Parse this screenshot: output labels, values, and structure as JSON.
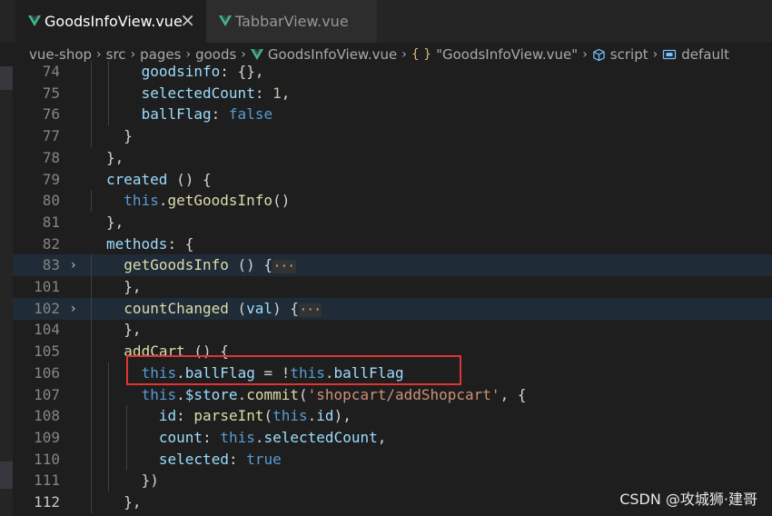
{
  "tabs": [
    {
      "label": "GoodsInfoView.vue",
      "active": true,
      "close": "×"
    },
    {
      "label": "TabbarView.vue",
      "active": false
    }
  ],
  "breadcrumb": {
    "parts": [
      "vue-shop",
      "src",
      "pages",
      "goods",
      "GoodsInfoView.vue"
    ],
    "object": "\"GoodsInfoView.vue\"",
    "script": "script",
    "default": "default"
  },
  "lines": [
    {
      "num": "74",
      "indent": 2,
      "tokens": [
        [
          "kw",
          "goodsinfo"
        ],
        [
          "p",
          ": {},"
        ]
      ]
    },
    {
      "num": "75",
      "indent": 2,
      "tokens": [
        [
          "kw",
          "selectedCount"
        ],
        [
          "p",
          ": "
        ],
        [
          "num",
          "1"
        ],
        [
          "p",
          ","
        ]
      ]
    },
    {
      "num": "76",
      "indent": 2,
      "tokens": [
        [
          "kw",
          "ballFlag"
        ],
        [
          "p",
          ": "
        ],
        [
          "bool",
          "false"
        ]
      ]
    },
    {
      "num": "77",
      "indent": 1,
      "tokens": [
        [
          "p",
          "}"
        ]
      ]
    },
    {
      "num": "78",
      "indent": 0,
      "tokens": [
        [
          "p",
          "},"
        ]
      ]
    },
    {
      "num": "79",
      "indent": 0,
      "tokens": [
        [
          "kw",
          "created"
        ],
        [
          "p",
          " () {"
        ]
      ]
    },
    {
      "num": "80",
      "indent": 1,
      "tokens": [
        [
          "this",
          "this"
        ],
        [
          "p",
          "."
        ],
        [
          "fn",
          "getGoodsInfo"
        ],
        [
          "p",
          "()"
        ]
      ]
    },
    {
      "num": "81",
      "indent": 0,
      "tokens": [
        [
          "p",
          "},"
        ]
      ]
    },
    {
      "num": "82",
      "indent": 0,
      "tokens": [
        [
          "kw",
          "methods"
        ],
        [
          "p",
          ": {"
        ]
      ]
    },
    {
      "num": "83",
      "indent": 1,
      "folded": true,
      "tokens": [
        [
          "fn",
          "getGoodsInfo"
        ],
        [
          "p",
          " () {"
        ],
        [
          "ell",
          "···"
        ]
      ]
    },
    {
      "num": "101",
      "indent": 1,
      "tokens": [
        [
          "p",
          "},"
        ]
      ]
    },
    {
      "num": "102",
      "indent": 1,
      "folded": true,
      "tokens": [
        [
          "fn",
          "countChanged"
        ],
        [
          "p",
          " ("
        ],
        [
          "kw",
          "val"
        ],
        [
          "p",
          ") {"
        ],
        [
          "ell",
          "···"
        ]
      ]
    },
    {
      "num": "104",
      "indent": 1,
      "tokens": [
        [
          "p",
          "},"
        ]
      ]
    },
    {
      "num": "105",
      "indent": 1,
      "tokens": [
        [
          "fn",
          "addCart"
        ],
        [
          "p",
          " () {"
        ]
      ]
    },
    {
      "num": "106",
      "indent": 2,
      "tokens": [
        [
          "this",
          "this"
        ],
        [
          "p",
          "."
        ],
        [
          "kw",
          "ballFlag"
        ],
        [
          "p",
          " = !"
        ],
        [
          "this",
          "this"
        ],
        [
          "p",
          "."
        ],
        [
          "kw",
          "ballFlag"
        ]
      ]
    },
    {
      "num": "107",
      "indent": 2,
      "tokens": [
        [
          "this",
          "this"
        ],
        [
          "p",
          "."
        ],
        [
          "kw",
          "$store"
        ],
        [
          "p",
          "."
        ],
        [
          "fn",
          "commit"
        ],
        [
          "p",
          "("
        ],
        [
          "str",
          "'shopcart/addShopcart'"
        ],
        [
          "p",
          ", {"
        ]
      ]
    },
    {
      "num": "108",
      "indent": 3,
      "tokens": [
        [
          "kw",
          "id"
        ],
        [
          "p",
          ": "
        ],
        [
          "fn",
          "parseInt"
        ],
        [
          "p",
          "("
        ],
        [
          "this",
          "this"
        ],
        [
          "p",
          "."
        ],
        [
          "kw",
          "id"
        ],
        [
          "p",
          "),"
        ]
      ]
    },
    {
      "num": "109",
      "indent": 3,
      "tokens": [
        [
          "kw",
          "count"
        ],
        [
          "p",
          ": "
        ],
        [
          "this",
          "this"
        ],
        [
          "p",
          "."
        ],
        [
          "kw",
          "selectedCount"
        ],
        [
          "p",
          ","
        ]
      ]
    },
    {
      "num": "110",
      "indent": 3,
      "tokens": [
        [
          "kw",
          "selected"
        ],
        [
          "p",
          ": "
        ],
        [
          "bool",
          "true"
        ]
      ]
    },
    {
      "num": "111",
      "indent": 2,
      "tokens": [
        [
          "p",
          "})"
        ]
      ]
    },
    {
      "num": "112",
      "indent": 1,
      "current": true,
      "tokens": [
        [
          "p",
          "},"
        ]
      ]
    }
  ],
  "fold_marker": "›",
  "watermark": "CSDN @攻城狮·建哥",
  "colors": {
    "editor_bg": "#1e1e1e",
    "keyword": "#9cdcfe",
    "function": "#dcdcaa",
    "string": "#ce9178",
    "boolean": "#569cd6",
    "number": "#b5cea8",
    "highlight_box": "#e03434"
  }
}
